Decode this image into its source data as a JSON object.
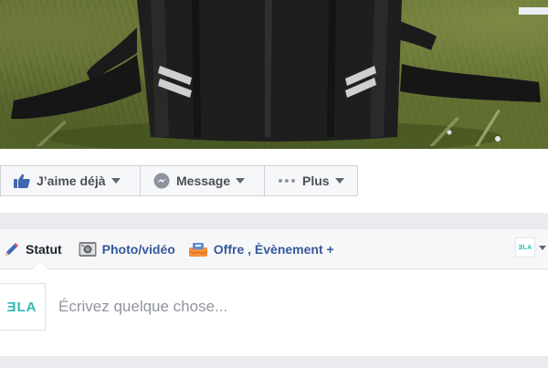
{
  "cover": {
    "image_description": "cover-photo-backpack-on-grass"
  },
  "actions": {
    "like_label": "J’aime déjà",
    "message_label": "Message",
    "more_label": "Plus"
  },
  "composer": {
    "tabs": [
      {
        "label": "Statut",
        "icon": "pencil-icon"
      },
      {
        "label": "Photo/vidéo",
        "icon": "camera-icon"
      },
      {
        "label": "Offre , Èvènement +",
        "icon": "offer-icon"
      }
    ],
    "page_logo_text": "ƎLA",
    "avatar_text": "ƎLA",
    "post_placeholder": "Écrivez quelque chose..."
  },
  "colors": {
    "link_blue": "#365899",
    "button_bg": "#f6f7f9",
    "separator": "#e9ebee",
    "brand_teal": "#2fb8b0"
  }
}
